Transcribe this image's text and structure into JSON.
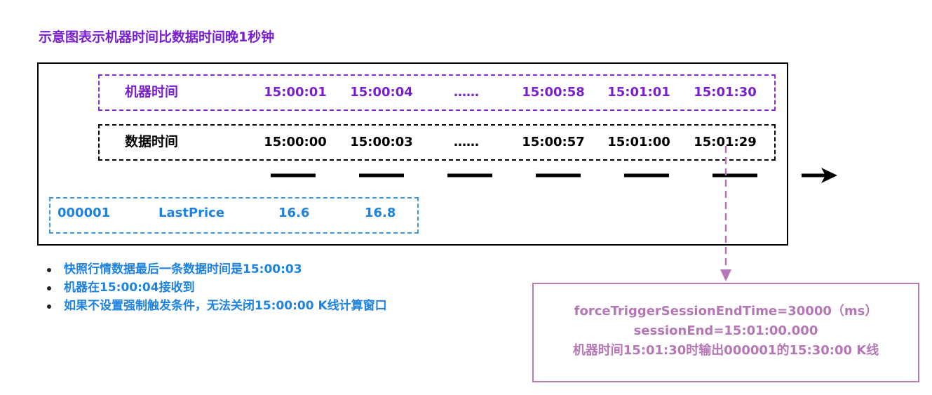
{
  "title": "示意图表示机器时间比数据时间晚1秒钟",
  "machine_row": {
    "label": "机器时间",
    "times": [
      "15:00:01",
      "15:00:04",
      "……",
      "15:00:58",
      "15:01:01",
      "15:01:30"
    ]
  },
  "data_row": {
    "label": "数据时间",
    "times": [
      "15:00:00",
      "15:00:03",
      "……",
      "15:00:57",
      "15:01:00",
      "15:01:29"
    ]
  },
  "price_row": {
    "code": "000001",
    "field": "LastPrice",
    "values": [
      "16.6",
      "16.8"
    ]
  },
  "notes": [
    "快照行情数据最后一条数据时间是15:00:03",
    "机器在15:00:04接收到",
    "如果不设置强制触发条件，无法关闭15:00:00 K线计算窗口"
  ],
  "result": {
    "line1": "forceTriggerSessionEndTime=30000（ms）",
    "line2": "sessionEnd=15:01:00.000",
    "line3": "机器时间15:01:30时输出000001的15:30:00 K线"
  },
  "colors": {
    "title": "#7a1fd0",
    "machine_border": "#8a2bd6",
    "notes_text": "#1e82e0",
    "price_border": "#3d9be9",
    "result_border": "#b57bb0",
    "result_text": "#b576b6",
    "connector": "#b576b6"
  }
}
